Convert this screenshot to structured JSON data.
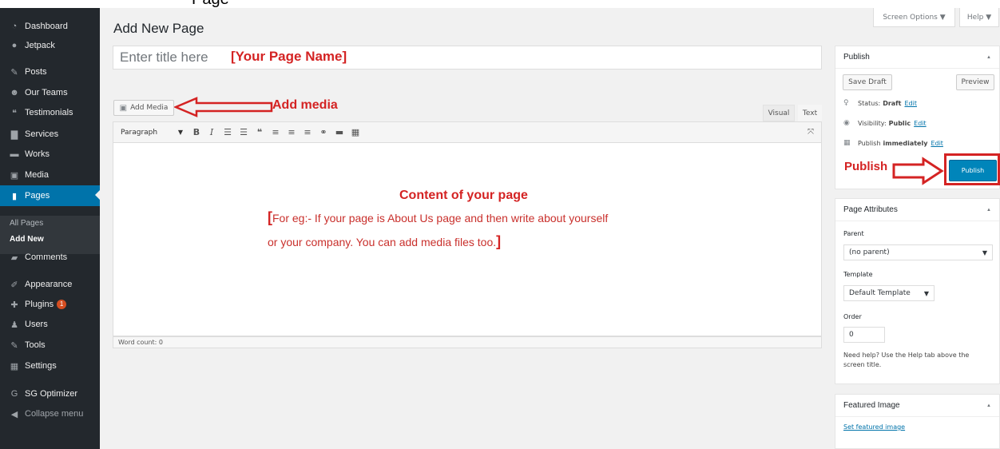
{
  "top_strip_text": "Page",
  "sidebar": {
    "items": [
      {
        "label": "Dashboard",
        "icon": "dashboard-icon",
        "glyph": "◔"
      },
      {
        "label": "Jetpack",
        "icon": "jetpack-icon",
        "glyph": "●"
      },
      {
        "label": "Posts",
        "icon": "pin-icon",
        "glyph": "✎"
      },
      {
        "label": "Our Teams",
        "icon": "teams-icon",
        "glyph": "☻"
      },
      {
        "label": "Testimonials",
        "icon": "quote-icon",
        "glyph": "❝"
      },
      {
        "label": "Services",
        "icon": "services-icon",
        "glyph": "▇"
      },
      {
        "label": "Works",
        "icon": "folder-icon",
        "glyph": "▬"
      },
      {
        "label": "Media",
        "icon": "media-icon",
        "glyph": "▣"
      },
      {
        "label": "Pages",
        "icon": "pages-icon",
        "glyph": "▮"
      },
      {
        "label": "Comments",
        "icon": "comment-icon",
        "glyph": "▰"
      },
      {
        "label": "Appearance",
        "icon": "brush-icon",
        "glyph": "✐"
      },
      {
        "label": "Plugins",
        "icon": "plugin-icon",
        "glyph": "✚",
        "badge": "1"
      },
      {
        "label": "Users",
        "icon": "users-icon",
        "glyph": "♟"
      },
      {
        "label": "Tools",
        "icon": "wrench-icon",
        "glyph": "✎"
      },
      {
        "label": "Settings",
        "icon": "settings-icon",
        "glyph": "▦"
      },
      {
        "label": "SG Optimizer",
        "icon": "sg-optimizer-icon",
        "glyph": "G"
      },
      {
        "label": "Collapse menu",
        "icon": "collapse-icon",
        "glyph": "◀"
      }
    ],
    "submenu": [
      "All Pages",
      "Add New"
    ]
  },
  "header": {
    "title": "Add New Page",
    "screen_options": "Screen Options ▼",
    "help": "Help ▼"
  },
  "title_field": {
    "placeholder": "Enter title here",
    "annotation": "[Your Page Name]"
  },
  "editor": {
    "add_media": "Add Media",
    "add_media_annotation": "Add media",
    "tab_visual": "Visual",
    "tab_text": "Text",
    "format": "Paragraph",
    "content_heading": "Content of your page",
    "content_line1_bracket": "[",
    "content_line1": "For eg:- If your page is About Us page and then write about yourself",
    "content_line2": "or your company. You can add media files too.",
    "content_line2_bracket": "]",
    "word_count": "Word count: 0"
  },
  "publish_box": {
    "title": "Publish",
    "save_draft": "Save Draft",
    "preview": "Preview",
    "status_label": "Status:",
    "status_value": "Draft",
    "visibility_label": "Visibility:",
    "visibility_value": "Public",
    "schedule_label": "Publish",
    "schedule_value": "immediately",
    "edit": "Edit",
    "publish_button": "Publish",
    "annotation": "Publish"
  },
  "page_attributes": {
    "title": "Page Attributes",
    "parent_label": "Parent",
    "parent_value": "(no parent)",
    "template_label": "Template",
    "template_value": "Default Template",
    "order_label": "Order",
    "order_value": "0",
    "help_text": "Need help? Use the Help tab above the screen title."
  },
  "featured_image": {
    "title": "Featured Image",
    "link": "Set featured image"
  },
  "colors": {
    "sidebar": "#23282d",
    "active": "#0073aa",
    "annotation": "#d42323",
    "primary_button": "#0085ba"
  }
}
